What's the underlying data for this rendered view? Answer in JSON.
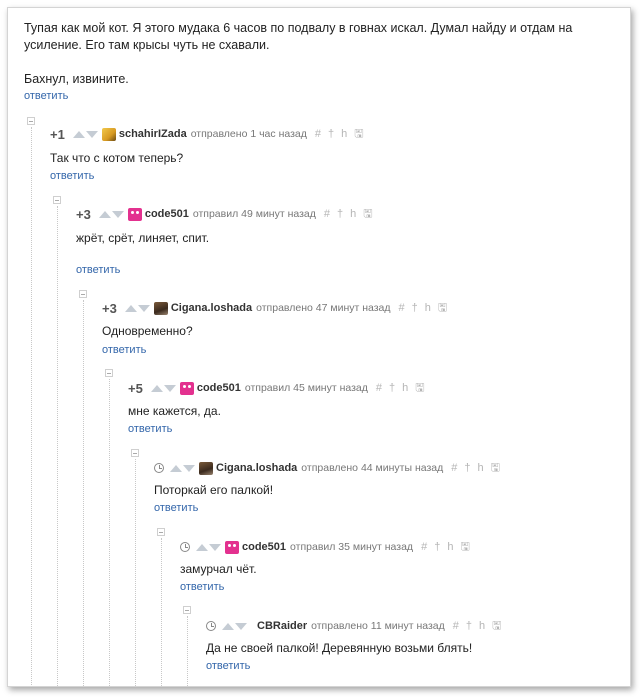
{
  "top_comment": {
    "line1": "Тупая как мой кот. Я этого мудака 6 часов по подвалу в говнах искал. Думал найду и отдам на усиление. Его там крысы чуть не схавали.",
    "line2": "Бахнул, извините.",
    "reply_label": "ответить"
  },
  "comments": [
    {
      "score": "+1",
      "username": "schahirIZada",
      "meta": "отправлено 1 час назад",
      "text": "Так что с котом теперь?",
      "reply_label": "ответить",
      "avatar": "yellow"
    },
    {
      "score": "+3",
      "username": "code501",
      "meta": "отправил 49 минут назад",
      "text": "жрёт, срёт, линяет, спит.",
      "reply_label": "ответить",
      "avatar": "pink"
    },
    {
      "score": "+3",
      "username": "Cigana.loshada",
      "meta": "отправлено 47 минут назад",
      "text": "Одновременно?",
      "reply_label": "ответить",
      "avatar": "photo"
    },
    {
      "score": "+5",
      "username": "code501",
      "meta": "отправил 45 минут назад",
      "text": "мне кажется, да.",
      "reply_label": "ответить",
      "avatar": "pink"
    },
    {
      "score": "",
      "username": "Cigana.loshada",
      "meta": "отправлено 44 минуты назад",
      "text": "Поторкай его палкой!",
      "reply_label": "ответить",
      "avatar": "photo"
    },
    {
      "score": "",
      "username": "code501",
      "meta": "отправил 35 минут назад",
      "text": "замурчал чёт.",
      "reply_label": "ответить",
      "avatar": "pink"
    },
    {
      "score": "",
      "username": "CBRaider",
      "meta": "отправлено 11 минут назад",
      "text": "Да не своей палкой! Деревянную возьми блять!",
      "reply_label": "ответить",
      "avatar": "none"
    }
  ],
  "tool_icons": {
    "anchor": "#",
    "parent": "†",
    "thread": "h",
    "save": "🖫"
  }
}
